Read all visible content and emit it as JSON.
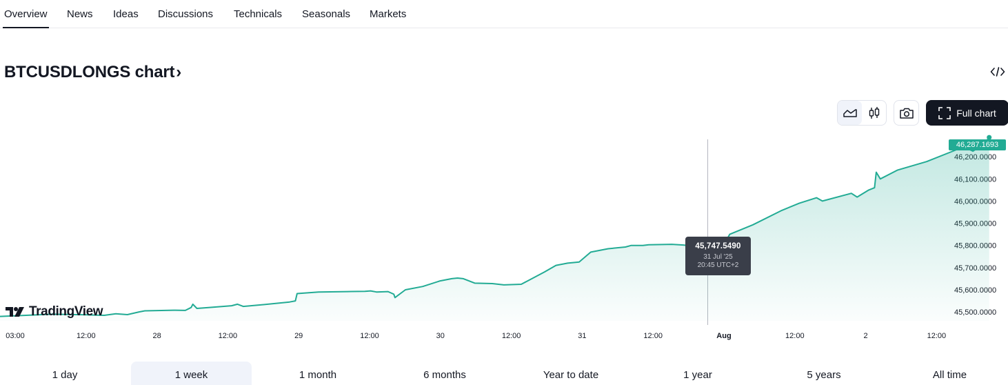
{
  "tabs": [
    {
      "label": "Overview",
      "active": true
    },
    {
      "label": "News"
    },
    {
      "label": "Ideas"
    },
    {
      "label": "Discussions"
    },
    {
      "label": "Technicals"
    },
    {
      "label": "Seasonals"
    },
    {
      "label": "Markets"
    }
  ],
  "chart_title": "BTCUSDLONGS chart",
  "chevron": "›",
  "toolbar": {
    "icons": [
      "line-chart-icon",
      "candles-icon",
      "camera-icon",
      "fullscreen-icon",
      "embed-code-icon"
    ],
    "full_chart_label": "Full chart"
  },
  "tooltip": {
    "price": "45,747.5490",
    "date": "31 Jul '25",
    "time": "20:45 UTC+2"
  },
  "last_price_label": "46,287.1693",
  "logo_text": "TradingView",
  "ranges": [
    {
      "label": "1 day"
    },
    {
      "label": "1 week",
      "active": true
    },
    {
      "label": "1 month"
    },
    {
      "label": "6 months"
    },
    {
      "label": "Year to date"
    },
    {
      "label": "1 year"
    },
    {
      "label": "5 years"
    },
    {
      "label": "All time"
    }
  ],
  "colors": {
    "line": "#22ab94",
    "accent_dark": "#131722",
    "tooltip_bg": "#3a3e49"
  },
  "chart_data": {
    "type": "area",
    "x_ticks": [
      "03:00",
      "12:00",
      "28",
      "12:00",
      "29",
      "12:00",
      "30",
      "12:00",
      "31",
      "12:00",
      "Aug",
      "12:00",
      "2",
      "12:00"
    ],
    "x_tick_bold": "Aug",
    "y_ticks": [
      "46,200.0000",
      "46,100.0000",
      "46,000.0000",
      "45,900.0000",
      "45,800.0000",
      "45,700.0000",
      "45,600.0000",
      "45,500.0000"
    ],
    "ylim": [
      45460,
      46300
    ],
    "x_range": [
      0,
      162
    ],
    "crosshair_x": 122.2,
    "tooltip_point": {
      "x": 122.2,
      "y": 45747.549
    },
    "last_point": {
      "x": 170.8,
      "y": 46287.1693
    },
    "series": [
      {
        "x": [
          0,
          9,
          15,
          18,
          20,
          22,
          24,
          25,
          30,
          32,
          33,
          33.3,
          34,
          36,
          40,
          41,
          42,
          45,
          50,
          51,
          51.3,
          55,
          60,
          63,
          64,
          65,
          67,
          68,
          68.2,
          70,
          73,
          76,
          78,
          79,
          80,
          82,
          85,
          87,
          90,
          94,
          96,
          98,
          100,
          102,
          105,
          108,
          109,
          111,
          112,
          116,
          118,
          119,
          121,
          122.2,
          124,
          126,
          130,
          135,
          138,
          141,
          142,
          147,
          148,
          150,
          151,
          151.3,
          152,
          155,
          160,
          165,
          166,
          168,
          170,
          170.8
        ],
        "y": [
          45480,
          45490,
          45487,
          45485,
          45492,
          45488,
          45500,
          45505,
          45508,
          45507,
          45520,
          45535,
          45516,
          45520,
          45528,
          45535,
          45525,
          45532,
          45545,
          45550,
          45583,
          45590,
          45592,
          45593,
          45595,
          45590,
          45592,
          45580,
          45565,
          45600,
          45615,
          45640,
          45650,
          45653,
          45650,
          45630,
          45628,
          45622,
          45625,
          45680,
          45710,
          45720,
          45725,
          45770,
          45785,
          45793,
          45800,
          45800,
          45803,
          45805,
          45802,
          45799,
          45780,
          45747.549,
          45760,
          45850,
          45893,
          45958,
          45990,
          46015,
          46000,
          46035,
          46018,
          46050,
          46060,
          46130,
          46100,
          46140,
          46178,
          46230,
          46250,
          46225,
          46260,
          46287.1693
        ]
      }
    ]
  }
}
